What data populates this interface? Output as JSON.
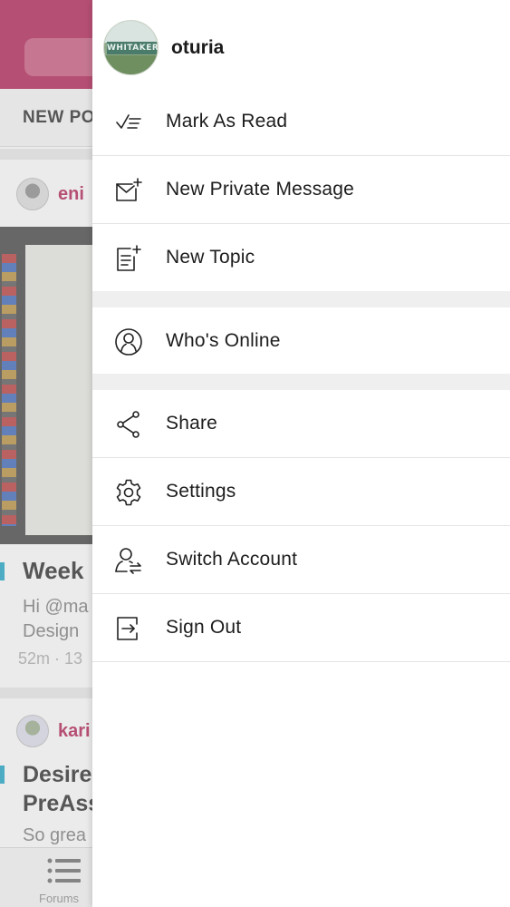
{
  "background_app": {
    "tab_label": "NEW PO",
    "post1": {
      "username": "eni",
      "title": "Week",
      "excerpt_line1": "Hi @ma",
      "excerpt_line2": "Design",
      "meta": "52m · 13"
    },
    "post2": {
      "username": "kari",
      "title_line1": "Desire",
      "title_line2": "PreAss",
      "excerpt": "So grea"
    },
    "bottom_tab": {
      "label": "Forums",
      "icon": "list-icon"
    },
    "colors": {
      "header": "#b0184f",
      "accent": "#12a2c5"
    }
  },
  "drawer": {
    "profile": {
      "username": "oturia",
      "avatar_text": "WHITAKER"
    },
    "groups": [
      {
        "items": [
          {
            "label": "Mark As Read",
            "icon": "mark-as-read-icon"
          },
          {
            "label": "New Private Message",
            "icon": "new-message-icon"
          },
          {
            "label": "New Topic",
            "icon": "new-topic-icon"
          }
        ]
      },
      {
        "items": [
          {
            "label": "Who's Online",
            "icon": "user-circle-icon"
          }
        ]
      },
      {
        "items": [
          {
            "label": "Share",
            "icon": "share-icon"
          },
          {
            "label": "Settings",
            "icon": "gear-icon"
          },
          {
            "label": "Switch Account",
            "icon": "switch-account-icon"
          },
          {
            "label": "Sign Out",
            "icon": "sign-out-icon"
          }
        ]
      }
    ]
  }
}
